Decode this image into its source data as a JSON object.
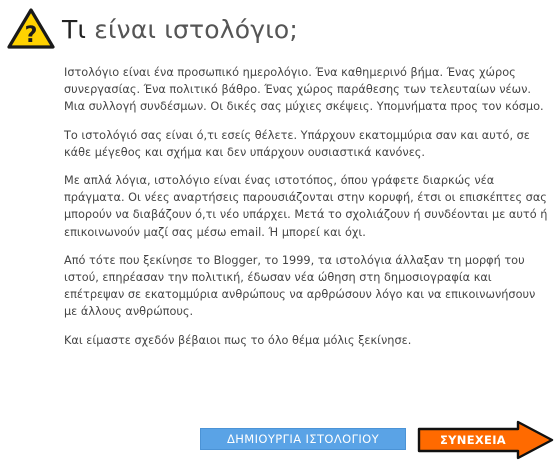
{
  "header": {
    "icon": "question-warning-icon",
    "title_first": "Τι",
    "title_rest": " είναι ιστολόγιο;"
  },
  "paragraphs": [
    "Ιστολόγιο είναι ένα προσωπικό ημερολόγιο. Ένα καθημερινό βήμα. Ένας χώρος συνεργασίας. Ένα πολιτικό βάθρο. Ένας χώρος παράθεσης των τελευταίων νέων. Μια συλλογή συνδέσμων. Οι δικές σας μύχιες σκέψεις. Υπομνήματα προς τον κόσμο.",
    "Το ιστολόγιό σας είναι ό,τι εσείς θέλετε. Υπάρχουν εκατομμύρια σαν και αυτό, σε κάθε μέγεθος και σχήμα και δεν υπάρχουν ουσιαστικά κανόνες.",
    "Με απλά λόγια, ιστολόγιο είναι ένας ιστοτόπος, όπου γράφετε διαρκώς νέα πράγματα. Οι νέες αναρτήσεις παρουσιάζονται στην κορυφή, έτσι οι επισκέπτες σας μπορούν να διαβάζουν ό,τι νέο υπάρχει. Μετά το σχολιάζουν ή συνδέονται με αυτό ή επικοινωνούν μαζί σας μέσω email. Ή μπορεί και όχι.",
    "Από τότε που ξεκίνησε το Blogger, το 1999, τα ιστολόγια άλλαξαν τη μορφή του ιστού, επηρέασαν την πολιτική, έδωσαν νέα ώθηση στη δημοσιογραφία και επέτρεψαν σε εκατομμύρια ανθρώπους να αρθρώσουν λόγο και να επικοινωνήσουν με άλλους ανθρώπους.",
    "Και είμαστε σχεδόν βέβαιοι πως το όλο θέμα μόλις ξεκίνησε."
  ],
  "actions": {
    "create_label": "ΔΗΜΙΟΥΡΓΙΑ ΙΣΤΟΛΟΓΙΟΥ",
    "continue_label": "ΣΥΝΕΧΕΙΑ",
    "continue_icon": "arrow-right-icon"
  },
  "colors": {
    "create_button": "#5aa3e6",
    "continue_button": "#ff6a00",
    "warning_yellow": "#ffd200"
  }
}
